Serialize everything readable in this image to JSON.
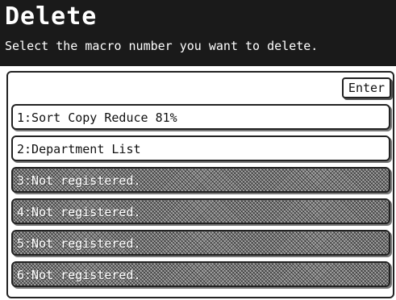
{
  "header": {
    "title": "Delete",
    "subtitle": "Select the macro number you want to delete."
  },
  "toolbar": {
    "enter_label": "Enter"
  },
  "macros": [
    {
      "label": "1:Sort Copy Reduce 81%",
      "registered": true
    },
    {
      "label": "2:Department List",
      "registered": true
    },
    {
      "label": "3:Not registered.",
      "registered": false
    },
    {
      "label": "4:Not registered.",
      "registered": false
    },
    {
      "label": "5:Not registered.",
      "registered": false
    },
    {
      "label": "6:Not registered.",
      "registered": false
    }
  ]
}
